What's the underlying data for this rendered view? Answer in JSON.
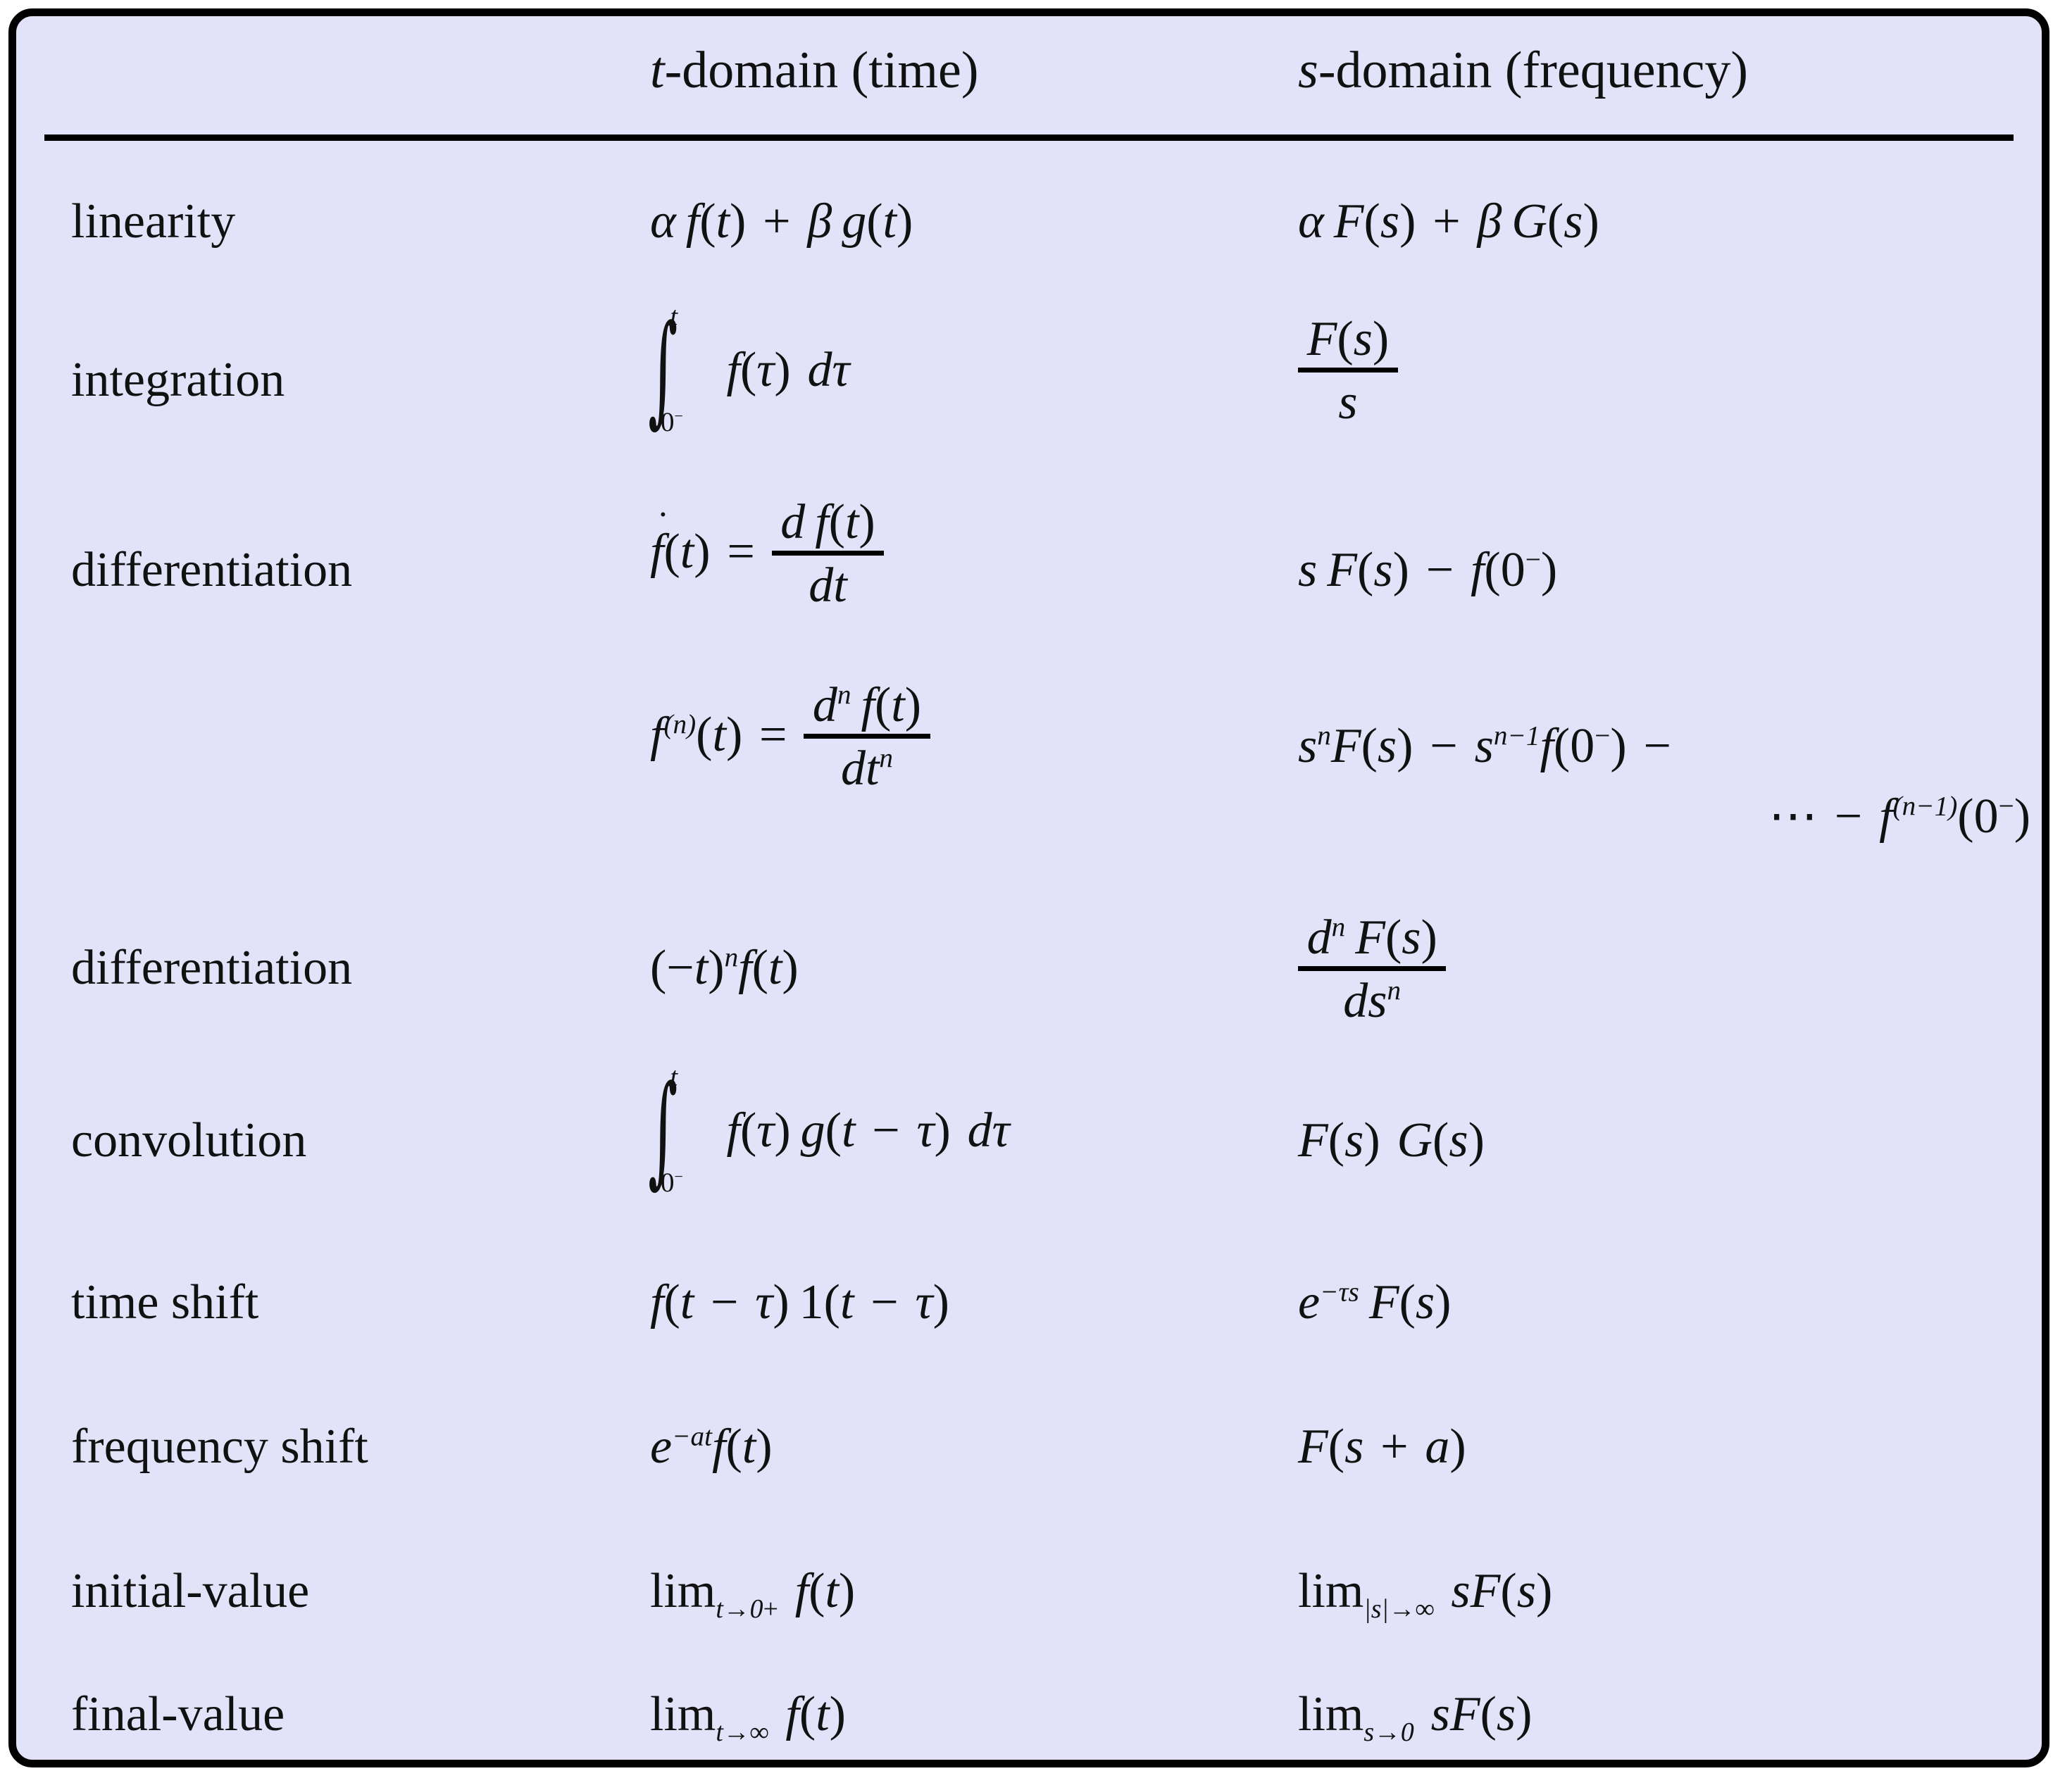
{
  "panel": {
    "background_color": "#e2e2f8",
    "border_color": "#000000"
  },
  "table": {
    "columns": [
      {
        "key": "name",
        "header": ""
      },
      {
        "key": "time",
        "header": "t-domain (time)"
      },
      {
        "key": "freq",
        "header": "s-domain (frequency)"
      }
    ],
    "header": {
      "name": "",
      "time_var": "t",
      "time_rest": "-domain (time)",
      "freq_var": "s",
      "freq_rest": "-domain (frequency)"
    },
    "rows": [
      {
        "name": "linearity",
        "time_text": "α f(t) + β g(t)",
        "freq_text": "α F(s) + β G(s)"
      },
      {
        "name": "integration",
        "time_text": "∫ from 0− to t of f(τ) dτ",
        "freq_text": "F(s) / s",
        "integral_lower": "0−",
        "integral_upper": "t",
        "integrand": "f(τ) dτ",
        "frac_num": "F(s)",
        "frac_den": "s"
      },
      {
        "name": "differentiation",
        "time_text": "ḟ(t) = d f(t) / dt",
        "freq_text": "s F(s) − f(0−)",
        "frac_num": "d f(t)",
        "frac_den": "dt"
      },
      {
        "name": "",
        "time_text": "f(n)(t) = dⁿ f(t) / dtⁿ",
        "freq_line1": "sⁿF(s) − sⁿ⁻¹f(0−) −",
        "freq_line2": "⋯ − f(n−1)(0−)",
        "frac_num": "dⁿ f(t)",
        "frac_den": "dtⁿ"
      },
      {
        "name": "differentiation",
        "time_text": "(−t)ⁿ f(t)",
        "freq_text": "dⁿ F(s) / dsⁿ",
        "frac_num": "dⁿ F(s)",
        "frac_den": "dsⁿ"
      },
      {
        "name": "convolution",
        "time_text": "∫ from 0− to t of f(τ) g(t − τ) dτ",
        "freq_text": "F(s) G(s)",
        "integral_lower": "0−",
        "integral_upper": "t",
        "integrand": "f(τ) g(t − τ) dτ"
      },
      {
        "name": "time shift",
        "time_text": "f(t − τ) 1(t − τ)",
        "freq_text": "e^(−τs) F(s)"
      },
      {
        "name": "frequency shift",
        "time_text": "e^(−at) f(t)",
        "freq_text": "F(s + a)"
      },
      {
        "name": "initial-value",
        "time_text": "lim t→0+ f(t)",
        "freq_text": "lim |s|→∞ sF(s)"
      },
      {
        "name": "final-value",
        "time_text": "lim t→∞ f(t)",
        "freq_text": "lim s→0 sF(s)"
      }
    ]
  }
}
